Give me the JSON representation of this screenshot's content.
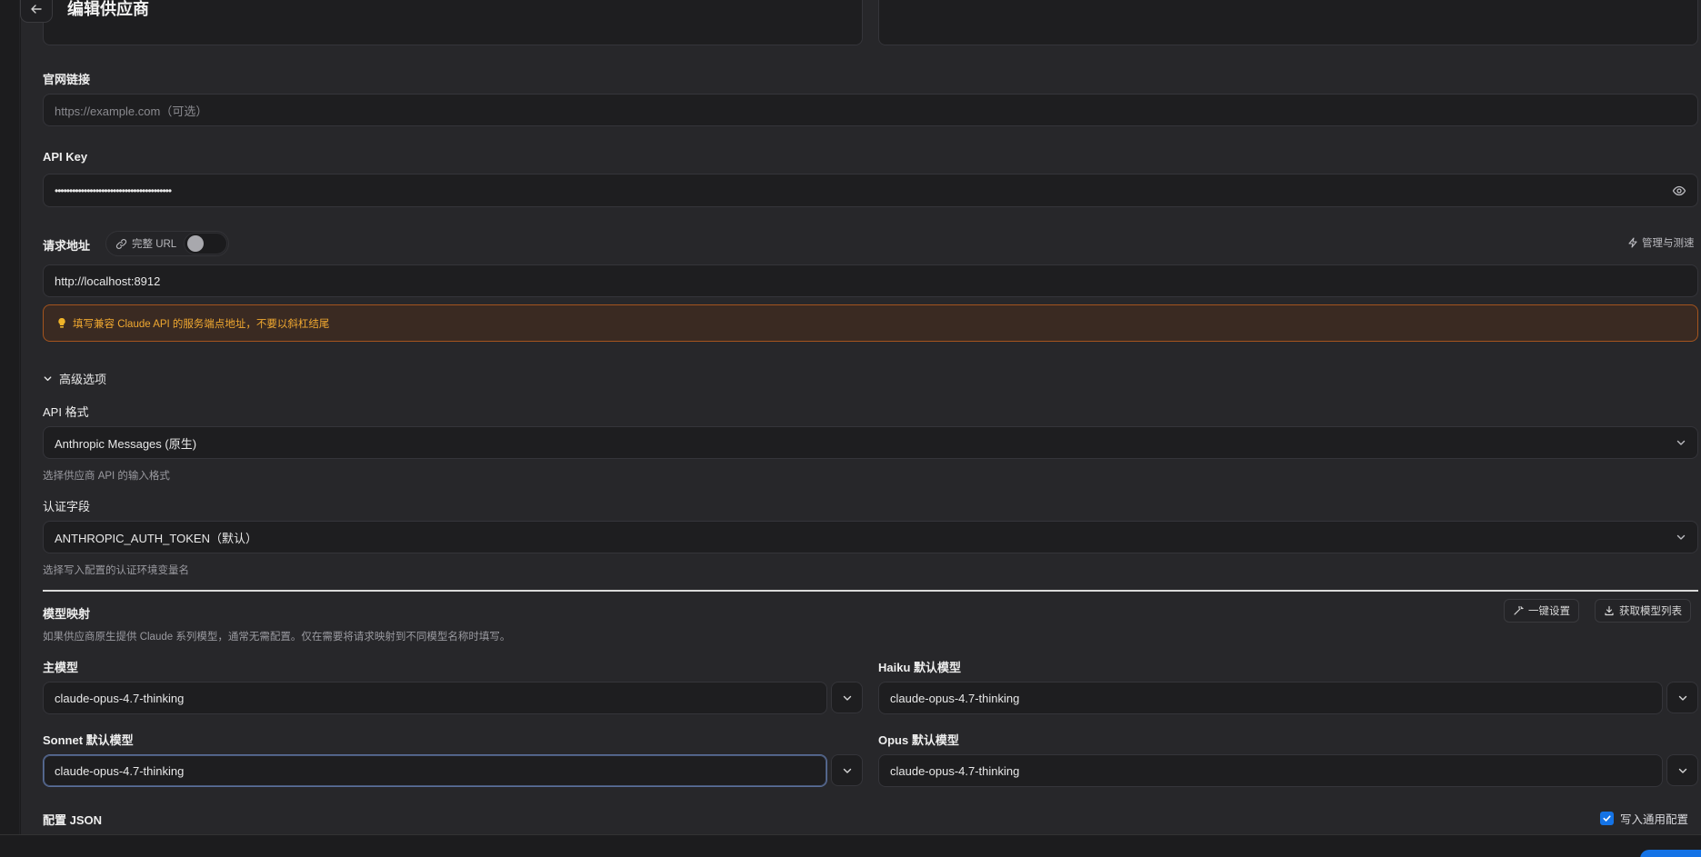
{
  "header": {
    "title": "编辑供应商",
    "back_icon": "arrow-left-icon"
  },
  "website": {
    "label": "官网链接",
    "placeholder": "https://example.com（可选）"
  },
  "api_key": {
    "label": "API Key",
    "value": "••••••••••••••••••••••••••••••••••••••••",
    "reveal_icon": "eye-icon"
  },
  "endpoint": {
    "label": "请求地址",
    "full_url_label": "完整 URL",
    "full_url_enabled": false,
    "manage_label": "管理与测速",
    "value": "http://localhost:8912",
    "warning": "填写兼容 Claude API 的服务端点地址，不要以斜杠结尾"
  },
  "advanced": {
    "toggle_label": "高级选项",
    "api_format": {
      "label": "API 格式",
      "selected": "Anthropic Messages (原生)",
      "hint": "选择供应商 API 的输入格式"
    },
    "auth_field": {
      "label": "认证字段",
      "selected": "ANTHROPIC_AUTH_TOKEN（默认）",
      "hint": "选择写入配置的认证环境变量名"
    }
  },
  "model_mapping": {
    "title": "模型映射",
    "description": "如果供应商原生提供 Claude 系列模型，通常无需配置。仅在需要将请求映射到不同模型名称时填写。",
    "one_click_label": "一键设置",
    "fetch_models_label": "获取模型列表",
    "main_model": {
      "label": "主模型",
      "value": "claude-opus-4.7-thinking"
    },
    "haiku_model": {
      "label": "Haiku 默认模型",
      "value": "claude-opus-4.7-thinking"
    },
    "sonnet_model": {
      "label": "Sonnet 默认模型",
      "value": "claude-opus-4.7-thinking"
    },
    "opus_model": {
      "label": "Opus 默认模型",
      "value": "claude-opus-4.7-thinking"
    }
  },
  "config_json": {
    "label": "配置 JSON",
    "write_common_label": "写入通用配置",
    "write_common_checked": true
  },
  "colors": {
    "accent": "#1473e6",
    "warning_text": "#f0a830",
    "warning_border": "#a4541e"
  }
}
